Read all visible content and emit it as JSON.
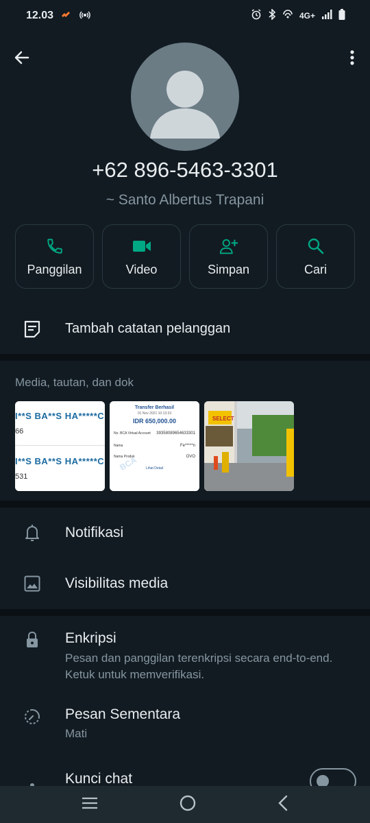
{
  "status_bar": {
    "time": "12.03",
    "network": "4G+"
  },
  "contact": {
    "phone": "+62 896-5463-3301",
    "name": "~ Santo Albertus Trapani"
  },
  "actions": [
    {
      "label": "Panggilan",
      "icon": "phone-icon"
    },
    {
      "label": "Video",
      "icon": "video-icon"
    },
    {
      "label": "Simpan",
      "icon": "add-person-icon"
    },
    {
      "label": "Cari",
      "icon": "search-icon"
    }
  ],
  "note": {
    "label": "Tambah catatan pelanggan"
  },
  "media": {
    "title": "Media, tautan, dan dok",
    "thumb1": {
      "line1": "I**S BA**S HA*****C",
      "num1": "66",
      "line2": "I**S BA**S HA*****C",
      "num2": "531"
    },
    "thumb2": {
      "title": "Transfer Berhasil",
      "date": "01 Nov 2021 10:13:33",
      "amount": "IDR 650,000.00",
      "va_label": "No. BCA Virtual Account",
      "va_value": "39358089654633301",
      "name_label": "Nama",
      "name_value": "Fe*****n",
      "product_label": "Nama Produk",
      "product_value": "OVO",
      "detail_link": "Lihat Detail",
      "watermark": "BCA"
    },
    "thumb3": {
      "sign": "SELECT"
    }
  },
  "settings": {
    "notifikasi": "Notifikasi",
    "visibilitas": "Visibilitas media",
    "enkripsi_title": "Enkripsi",
    "enkripsi_sub": "Pesan dan panggilan terenkripsi secara end-to-end. Ketuk untuk memverifikasi.",
    "pesan_title": "Pesan Sementara",
    "pesan_sub": "Mati",
    "kunci_title": "Kunci chat",
    "kunci_enabled": false
  },
  "colors": {
    "accent": "#00a884",
    "background": "#121b22",
    "text": "#e9edef",
    "secondary": "#8696a0"
  }
}
